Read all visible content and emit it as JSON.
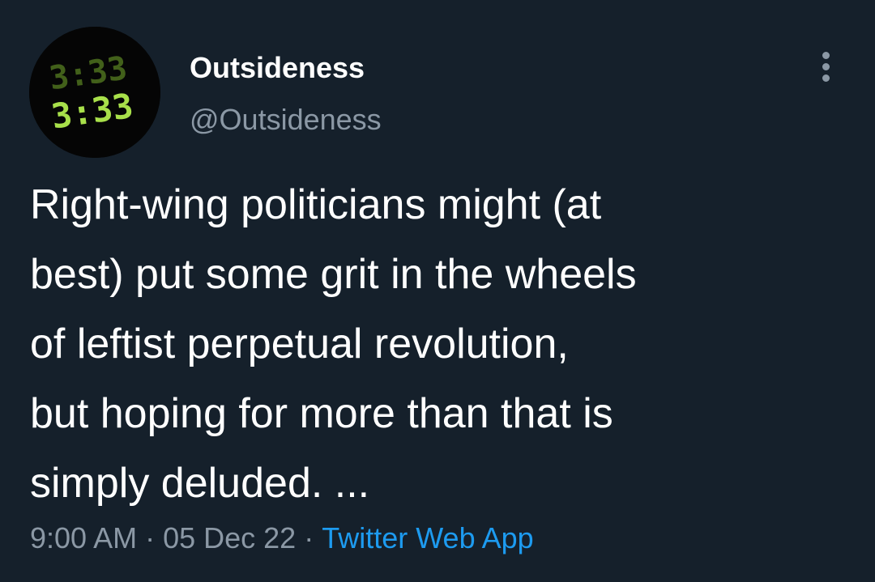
{
  "tweet": {
    "author": {
      "display_name": "Outsideness",
      "handle": "@Outsideness",
      "avatar_text_top": "3:33",
      "avatar_text_bottom": "3:33"
    },
    "body": "Right-wing politicians might (at\nbest) put some grit in the wheels\nof leftist perpetual revolution,\nbut hoping for more than that is\nsimply deluded. ...",
    "time": "9:00 AM",
    "separator": "·",
    "date": "05 Dec 22",
    "source": "Twitter Web App"
  },
  "colors": {
    "background": "#15202b",
    "text_primary": "#ffffff",
    "text_secondary": "#8b98a5",
    "link": "#1d9bf0",
    "avatar_digits": "#a8e04a"
  },
  "icons": {
    "more_menu": "more-vertical-icon"
  }
}
